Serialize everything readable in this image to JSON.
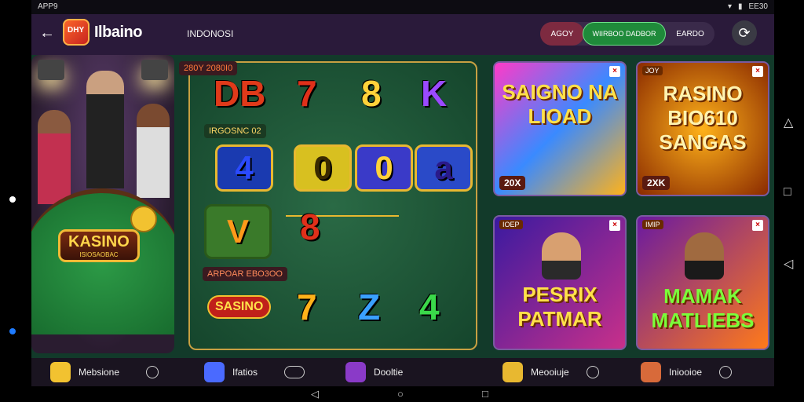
{
  "status": {
    "time": "APP9",
    "battery": "EE30"
  },
  "appbar": {
    "back_label": "←",
    "logo_text": "DHY",
    "brand": "Ilbaino",
    "region": "INDONOSI",
    "pill1": "AGOY",
    "pill2": "WIIRBOO DADBOR",
    "pill3": "EARDO",
    "refresh_icon": "⟳"
  },
  "hero": {
    "badge": "KASINO",
    "badge_sub": "ISIOSAOBAC"
  },
  "board": {
    "tag1": "280Y 2080I0",
    "tag2": "IRGOSNC 02",
    "tag3": "ARPOAR EBO3OO",
    "row1": [
      "DB",
      "7",
      "8",
      "K"
    ],
    "row2": [
      "4",
      "0",
      "0",
      "a"
    ],
    "row3_v": "V",
    "row3_sym": "8",
    "row4_logo": "SASINO",
    "row4": [
      "7",
      "Z",
      "4"
    ]
  },
  "cards": [
    {
      "label": "",
      "title": "SAIGNO NA LIOAD",
      "bottom": "20X"
    },
    {
      "label": "JOY",
      "title": "RASINO BIO610 SANGAS",
      "bottom": "2XK"
    },
    {
      "label": "IOEP",
      "title": "PESRIX PATMAR",
      "bottom": ""
    },
    {
      "label": "IMIP",
      "title": "MAMAK MATLIEBS",
      "bottom": ""
    }
  ],
  "nav": [
    {
      "label": "Mebsione",
      "color": "#f2c230"
    },
    {
      "label": "Ifatios",
      "color": "#4a6aff"
    },
    {
      "label": "Dooltie",
      "color": "#8a3ac8"
    },
    {
      "label": "Meooiuje",
      "color": "#e8b830"
    },
    {
      "label": "Iniooioe",
      "color": "#d86a3a"
    }
  ],
  "sysnav": {
    "back": "◁",
    "home": "○",
    "recent": "□"
  },
  "sideicons": {
    "triangle": "△",
    "square": "□",
    "back": "◁"
  }
}
